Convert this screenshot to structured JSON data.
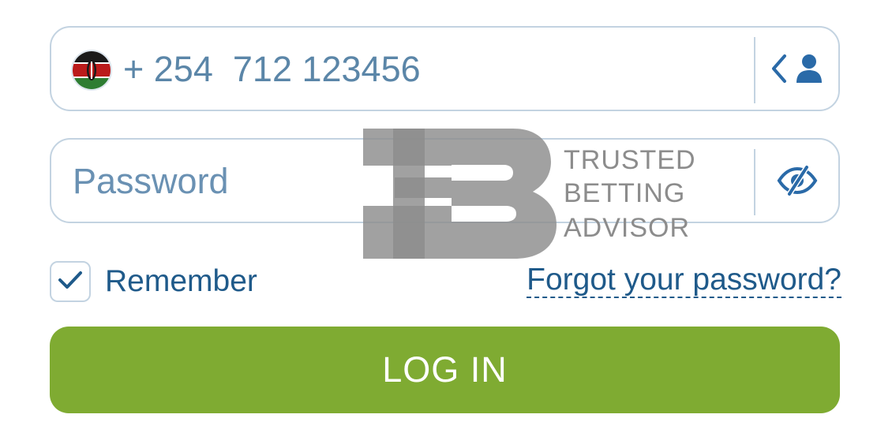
{
  "phone": {
    "country_code": "+ 254",
    "number": "712 123456",
    "flag": "kenya-flag",
    "contacts_icon": "chevron-left-user-icon"
  },
  "password": {
    "placeholder": "Password",
    "visibility_icon": "eye-slash-icon"
  },
  "remember": {
    "label": "Remember",
    "checked": true
  },
  "forgot_link": "Forgot your password?",
  "login_button": "LOG IN",
  "watermark": {
    "logo": "tb-logo",
    "line1": "TRUSTED",
    "line2": "BETTING",
    "line3": "ADVISOR"
  },
  "colors": {
    "accent_green": "#7fab32",
    "link_blue": "#1f5a8a",
    "field_border": "#c3d3e1",
    "icon_blue": "#2a6aa8"
  }
}
